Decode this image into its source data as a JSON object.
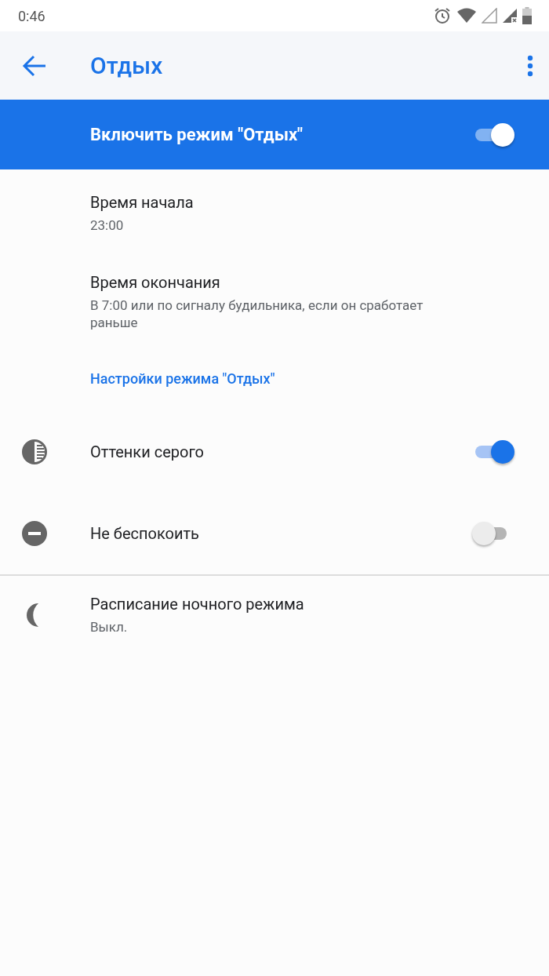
{
  "status_bar": {
    "time": "0:46"
  },
  "app_bar": {
    "title": "Отдых"
  },
  "master_switch": {
    "label": "Включить режим \"Отдых\"",
    "on": true
  },
  "schedule": [
    {
      "title": "Время начала",
      "summary": "23:00"
    },
    {
      "title": "Время окончания",
      "summary": "В 7:00 или по сигналу будильника, если он сработает раньше"
    }
  ],
  "settings_link": "Настройки режима \"Отдых\"",
  "toggles": [
    {
      "title": "Оттенки серого",
      "on": true
    },
    {
      "title": "Не беспокоить",
      "on": false
    }
  ],
  "night_light": {
    "title": "Расписание ночного режима",
    "summary": "Выкл."
  }
}
